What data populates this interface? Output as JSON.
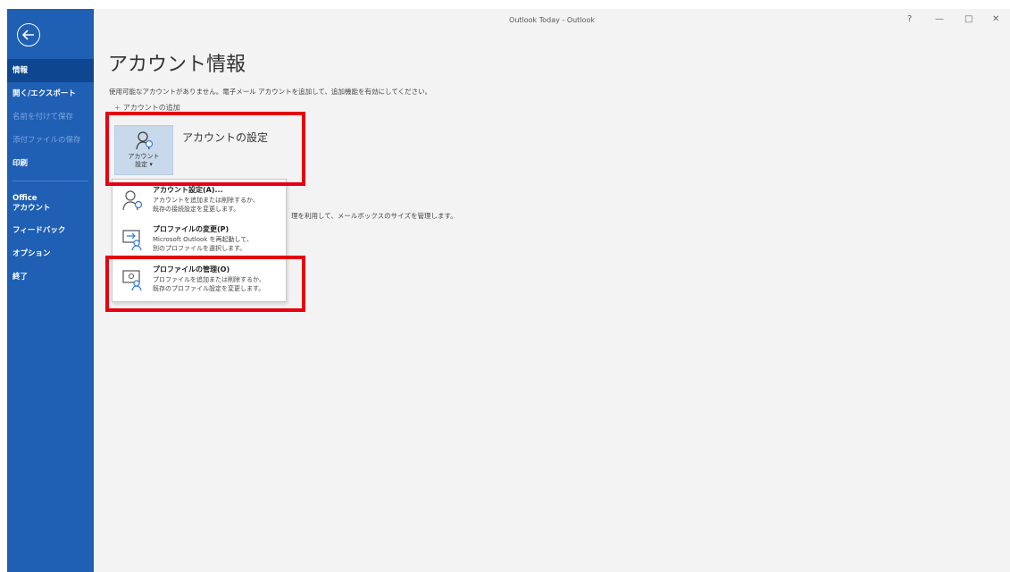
{
  "window": {
    "title": "Outlook Today  -  Outlook",
    "controls": {
      "help": "?",
      "minimize": "—",
      "maximize": "□",
      "close": "✕"
    }
  },
  "sidebar": {
    "back_icon": "back-arrow-icon",
    "items": [
      {
        "label": "情報",
        "state": "active"
      },
      {
        "label": "開く/エクスポート",
        "state": "normal"
      },
      {
        "label": "名前を付けて保存",
        "state": "disabled"
      },
      {
        "label": "添付ファイルの保存",
        "state": "disabled"
      },
      {
        "label": "印刷",
        "state": "normal"
      },
      {
        "label": "Office\nアカウント",
        "state": "normal"
      },
      {
        "label": "フィードバック",
        "state": "normal"
      },
      {
        "label": "オプション",
        "state": "normal"
      },
      {
        "label": "終了",
        "state": "normal"
      }
    ]
  },
  "main": {
    "title": "アカウント情報",
    "description": "使用可能なアカウントがありません。電子メール アカウントを追加して、追加機能を有効にしてください。",
    "add_account_label": "アカウントの追加",
    "account_settings_button": {
      "line1": "アカウント",
      "line2": "設定 ▾"
    },
    "account_settings_heading": "アカウントの設定",
    "background_text": "理を利用して、メールボックスのサイズを管理します。"
  },
  "dropdown": {
    "items": [
      {
        "title": "アカウント設定(A)...",
        "desc1": "アカウントを追加または削除するか、",
        "desc2": "既存の接続設定を変更します。",
        "icon": "account-settings-icon"
      },
      {
        "title": "プロファイルの変更(P)",
        "desc1": "Microsoft Outlook を再起動して、",
        "desc2": "別のプロファイルを選択します。",
        "icon": "change-profile-icon"
      },
      {
        "title": "プロファイルの管理(O)",
        "desc1": "プロファイルを追加または削除するか、",
        "desc2": "既存のプロファイル設定を変更します。",
        "icon": "manage-profiles-icon"
      }
    ]
  },
  "colors": {
    "sidebar": "#1f5fb4",
    "sidebar_active": "#0e4790",
    "highlight": "#e60012",
    "button_bg": "#c9d9ec"
  }
}
